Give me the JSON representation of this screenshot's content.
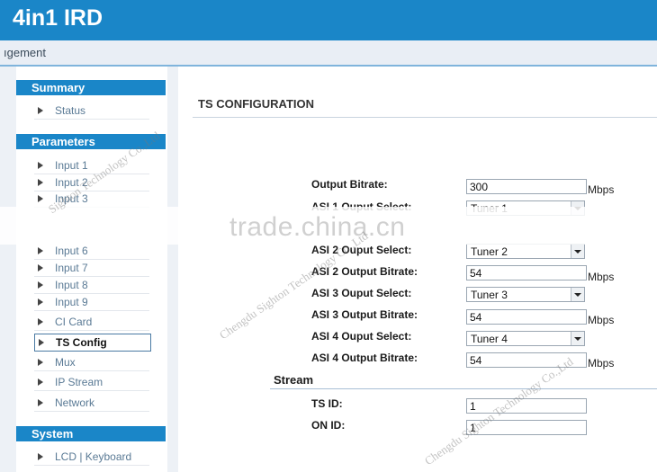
{
  "header": {
    "title": "4in1 IRD"
  },
  "subbar": {
    "text": "ıgement"
  },
  "sidebar": {
    "sections": [
      {
        "label": "Summary"
      },
      {
        "label": "Parameters"
      },
      {
        "label": "System"
      }
    ],
    "items": [
      {
        "label": "Status"
      },
      {
        "label": "Input 1"
      },
      {
        "label": "Input 2"
      },
      {
        "label": "Input 3"
      },
      {
        "label": "Input 6"
      },
      {
        "label": "Input 7"
      },
      {
        "label": "Input 8"
      },
      {
        "label": "Input 9"
      },
      {
        "label": "CI Card"
      },
      {
        "label": "TS Config"
      },
      {
        "label": "Mux"
      },
      {
        "label": "IP Stream"
      },
      {
        "label": "Network"
      },
      {
        "label": "LCD | Keyboard"
      }
    ]
  },
  "main": {
    "title": "TS CONFIGURATION",
    "fields": [
      {
        "label": "Output Bitrate:",
        "value": "300",
        "unit": "Mbps"
      },
      {
        "label": "ASI 1 Ouput Select:",
        "value": "Tuner 1"
      },
      {
        "label": "ASI 2 Ouput Select:",
        "value": "Tuner 2"
      },
      {
        "label": "ASI 2 Output Bitrate:",
        "value": "54",
        "unit": "Mbps"
      },
      {
        "label": "ASI 3 Ouput Select:",
        "value": "Tuner 3"
      },
      {
        "label": "ASI 3 Output Bitrate:",
        "value": "54",
        "unit": "Mbps"
      },
      {
        "label": "ASI 4 Ouput Select:",
        "value": "Tuner 4"
      },
      {
        "label": "ASI 4 Output Bitrate:",
        "value": "54",
        "unit": "Mbps"
      }
    ],
    "stream": {
      "header": "Stream",
      "fields": [
        {
          "label": "TS ID:",
          "value": "1"
        },
        {
          "label": "ON ID:",
          "value": "1"
        }
      ]
    }
  },
  "watermarks": {
    "main": "trade.china.cn",
    "company": "Chengdu Sighton Technology Co.,Ltd",
    "company_short": "Sighton Technology Co.,Ltd"
  },
  "colors": {
    "brand": "#1a86c8",
    "background": "#ffffff",
    "panel": "#edf1f6"
  }
}
